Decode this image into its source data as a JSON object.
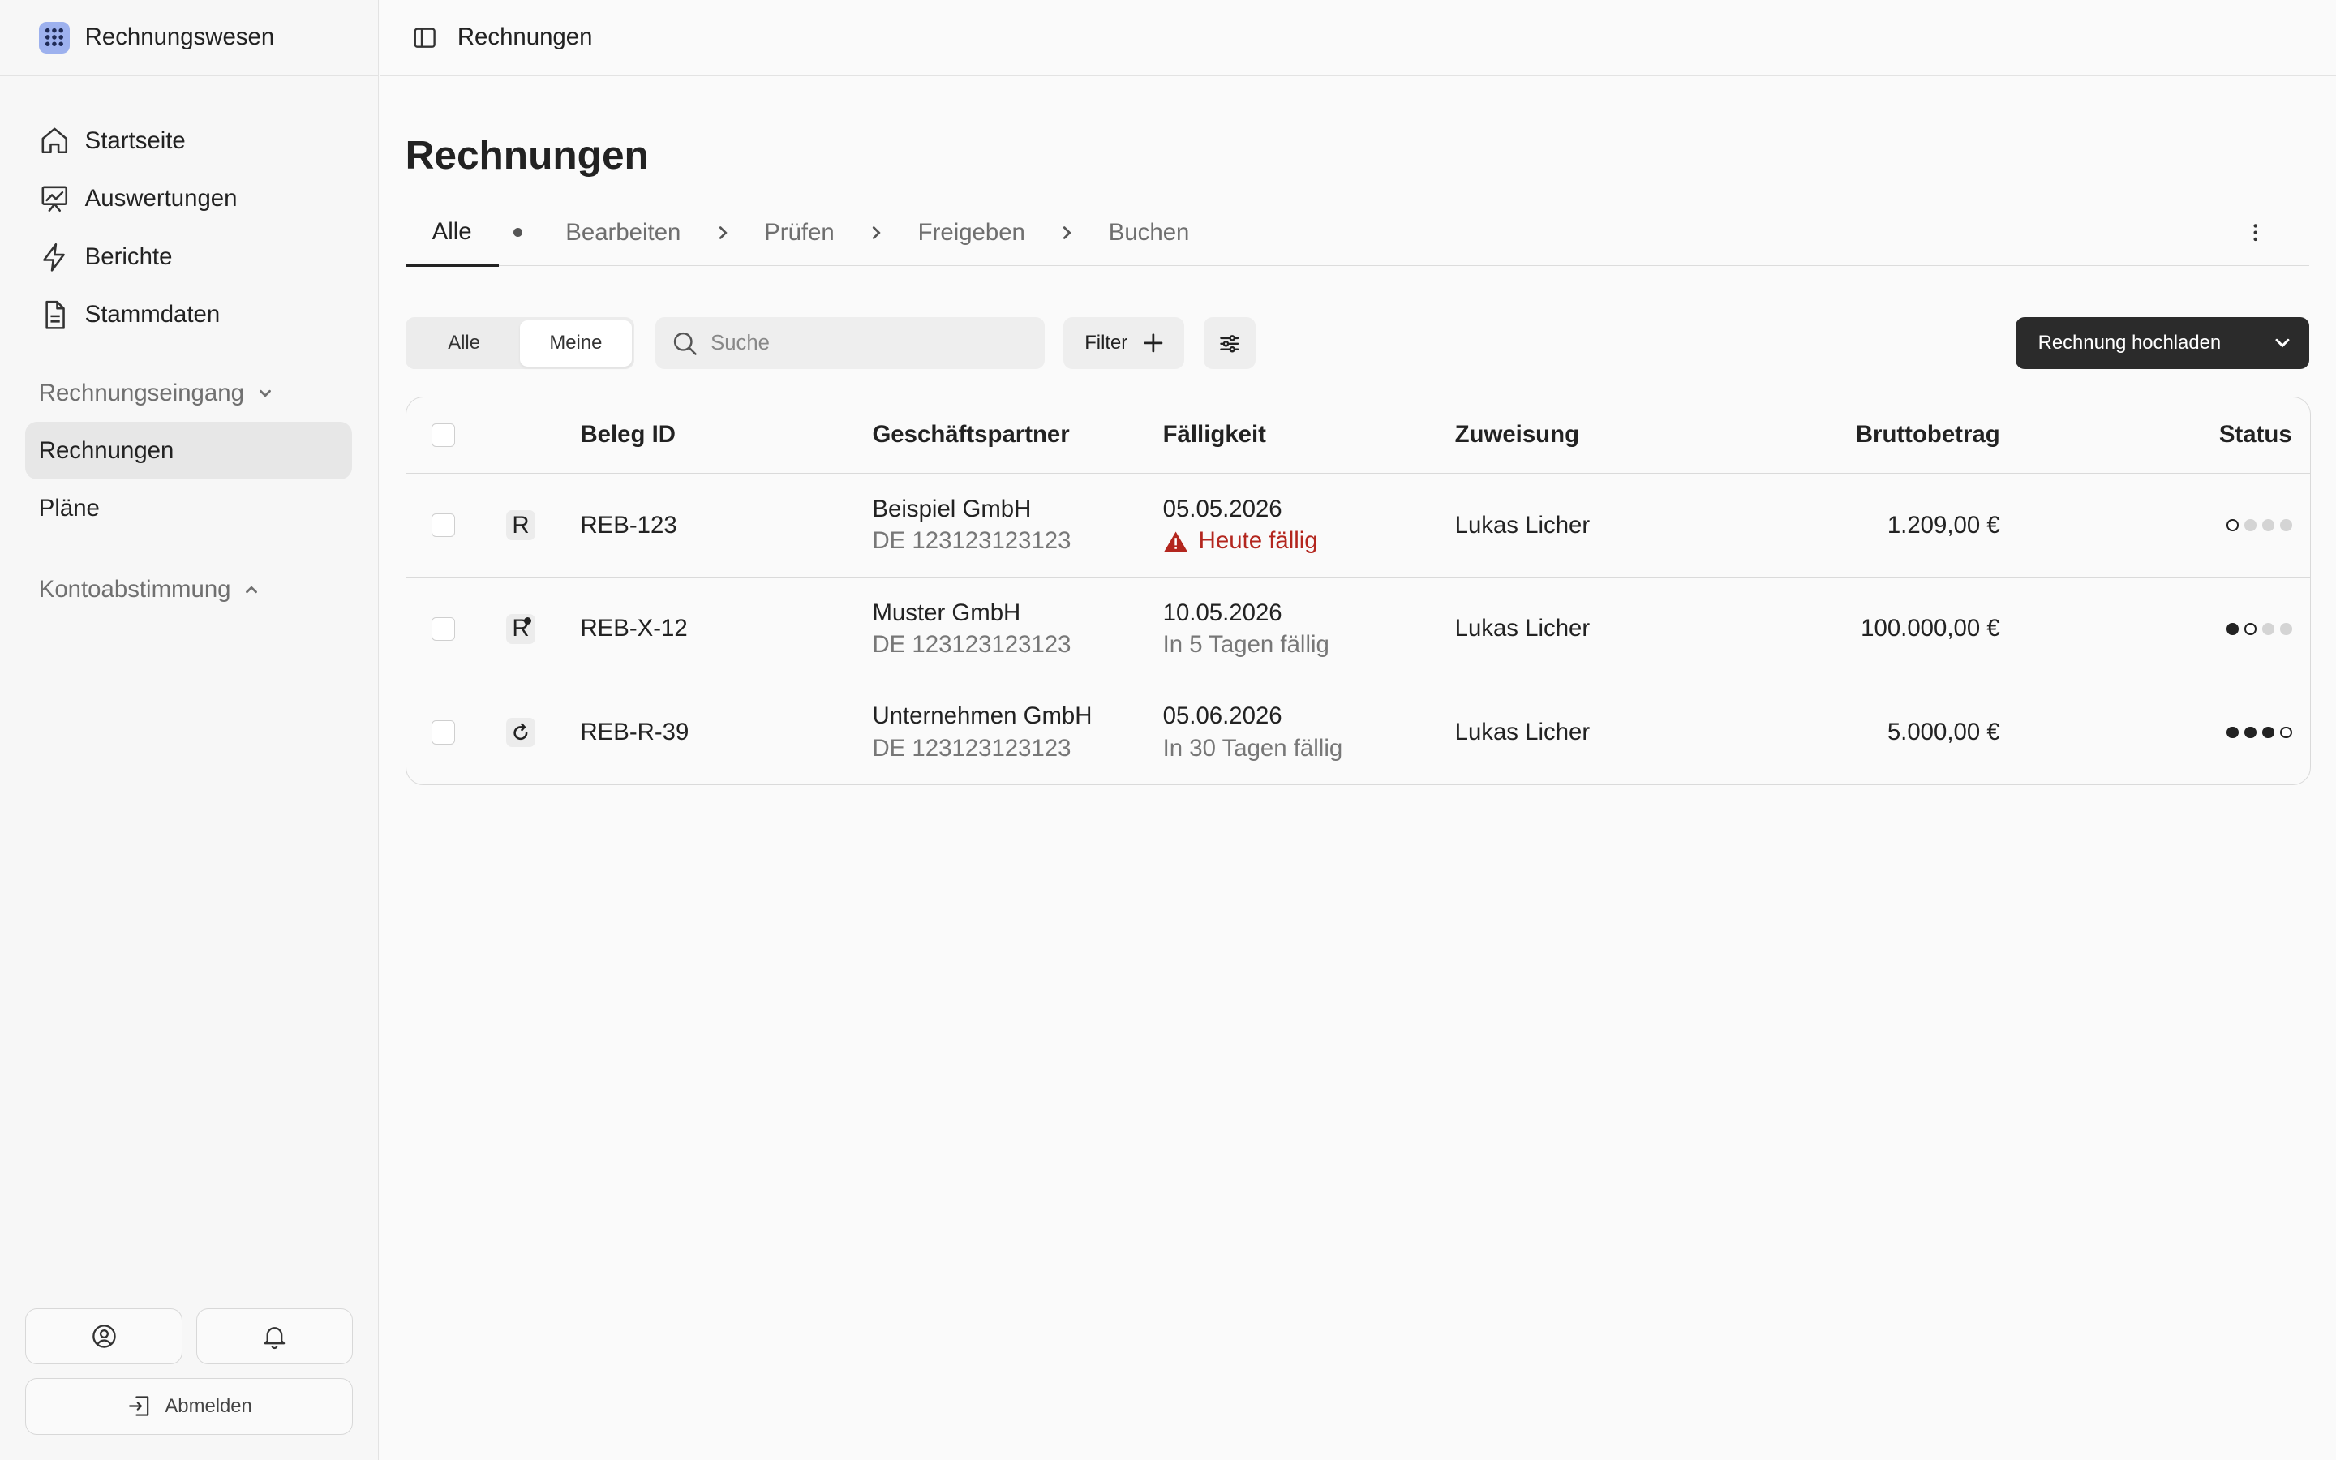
{
  "app": {
    "name": "Rechnungswesen"
  },
  "sidebar": {
    "nav": [
      {
        "label": "Startseite",
        "icon": "home-icon"
      },
      {
        "label": "Auswertungen",
        "icon": "chart-icon"
      },
      {
        "label": "Berichte",
        "icon": "bolt-icon"
      },
      {
        "label": "Stammdaten",
        "icon": "document-icon"
      }
    ],
    "section_incoming": {
      "label": "Rechnungseingang",
      "expanded": true
    },
    "sub_items": [
      "Rechnungen",
      "Pläne"
    ],
    "active_sub_item": "Rechnungen",
    "section_reconciliation": {
      "label": "Kontoabstimmung",
      "expanded": false
    },
    "logout_label": "Abmelden"
  },
  "topbar": {
    "title": "Rechnungen"
  },
  "page": {
    "title": "Rechnungen"
  },
  "steps": {
    "all": "Alle",
    "items": [
      "Bearbeiten",
      "Prüfen",
      "Freigeben",
      "Buchen"
    ]
  },
  "toolbar": {
    "scope_all": "Alle",
    "scope_mine": "Meine",
    "active_scope": "Meine",
    "search_placeholder": "Suche",
    "filter_label": "Filter",
    "upload_label": "Rechnung hochladen"
  },
  "table": {
    "columns": [
      "Beleg ID",
      "Geschäftspartner",
      "Fälligkeit",
      "Zuweisung",
      "Bruttobetrag",
      "Status"
    ],
    "rows": [
      {
        "type_icon": "R",
        "id": "REB-123",
        "partner": "Beispiel GmbH",
        "vat_id": "DE 123123123123",
        "due_date": "05.05.2026",
        "due_note": "Heute fällig",
        "due_urgent": true,
        "assignee": "Lukas Licher",
        "amount": "1.209,00 €",
        "status": [
          "current",
          "todo",
          "todo",
          "todo"
        ]
      },
      {
        "type_icon": "R",
        "id": "REB-X-12",
        "partner": "Muster GmbH",
        "vat_id": "DE 123123123123",
        "due_date": "10.05.2026",
        "due_note": "In 5 Tagen fällig",
        "due_urgent": false,
        "assignee": "Lukas Licher",
        "amount": "100.000,00 €",
        "status": [
          "done",
          "current",
          "todo",
          "todo"
        ]
      },
      {
        "type_icon": "recurring-icon",
        "id": "REB-R-39",
        "partner": "Unternehmen GmbH",
        "vat_id": "DE 123123123123",
        "due_date": "05.06.2026",
        "due_note": "In 30 Tagen fällig",
        "due_urgent": false,
        "assignee": "Lukas Licher",
        "amount": "5.000,00 €",
        "status": [
          "done",
          "done",
          "done",
          "current"
        ]
      }
    ]
  },
  "colors": {
    "accent": "#2b2b2b",
    "brand_logo": "#9db1ee",
    "danger": "#b3261e",
    "active_nav": "#e7e7e7"
  }
}
